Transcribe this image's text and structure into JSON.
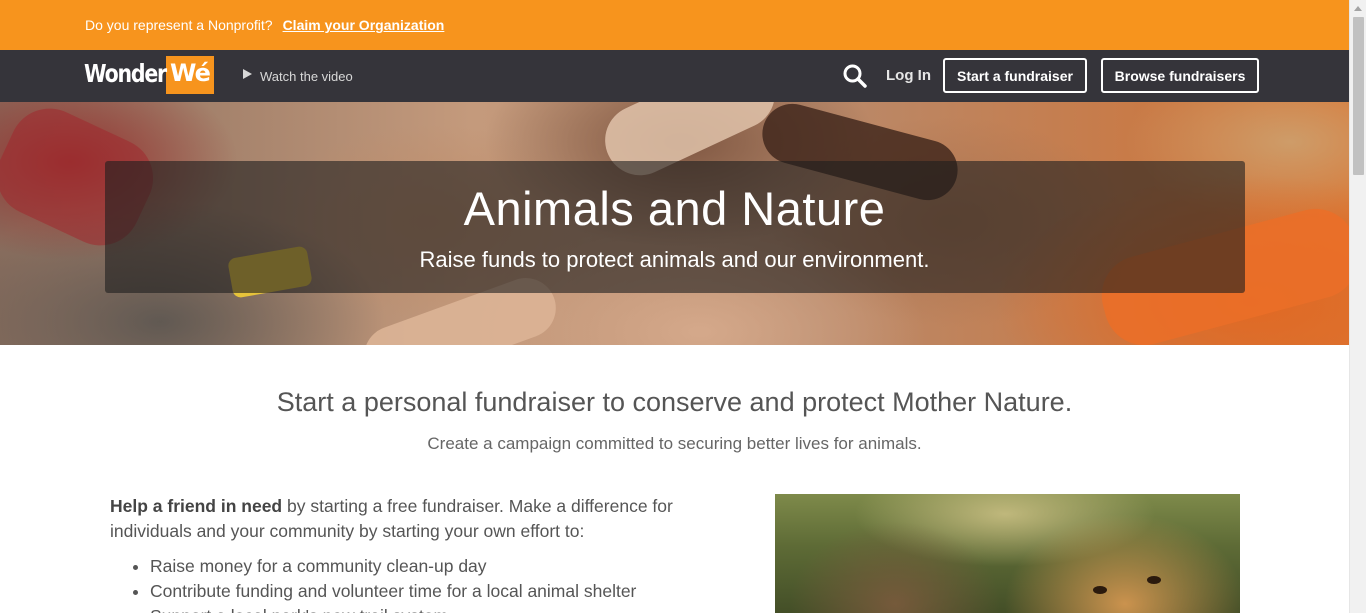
{
  "banner": {
    "question": "Do you represent a Nonprofit?",
    "link": "Claim your Organization"
  },
  "nav": {
    "logo_wonder": "Wonder",
    "logo_we": "Wé",
    "watch_video": "Watch the video",
    "search_icon": "search-icon",
    "login": "Log In",
    "start_button": "Start a fundraiser",
    "browse_button": "Browse fundraisers"
  },
  "hero": {
    "title": "Animals and Nature",
    "subtitle": "Raise funds to protect animals and our environment."
  },
  "intro": {
    "title": "Start a personal fundraiser to conserve and protect Mother Nature.",
    "subtitle": "Create a campaign committed to securing better lives for animals."
  },
  "body": {
    "lead_bold": "Help a friend in need",
    "lead_rest": " by starting a free fundraiser. Make a difference for individuals and your community by starting your own effort to:",
    "items": [
      "Raise money for a community clean-up day",
      "Contribute funding and volunteer time for a local animal shelter",
      "Support a local park's new trail system"
    ]
  },
  "colors": {
    "banner": "#f7941d",
    "nav": "#35343a",
    "brand_orange": "#f7941d"
  }
}
